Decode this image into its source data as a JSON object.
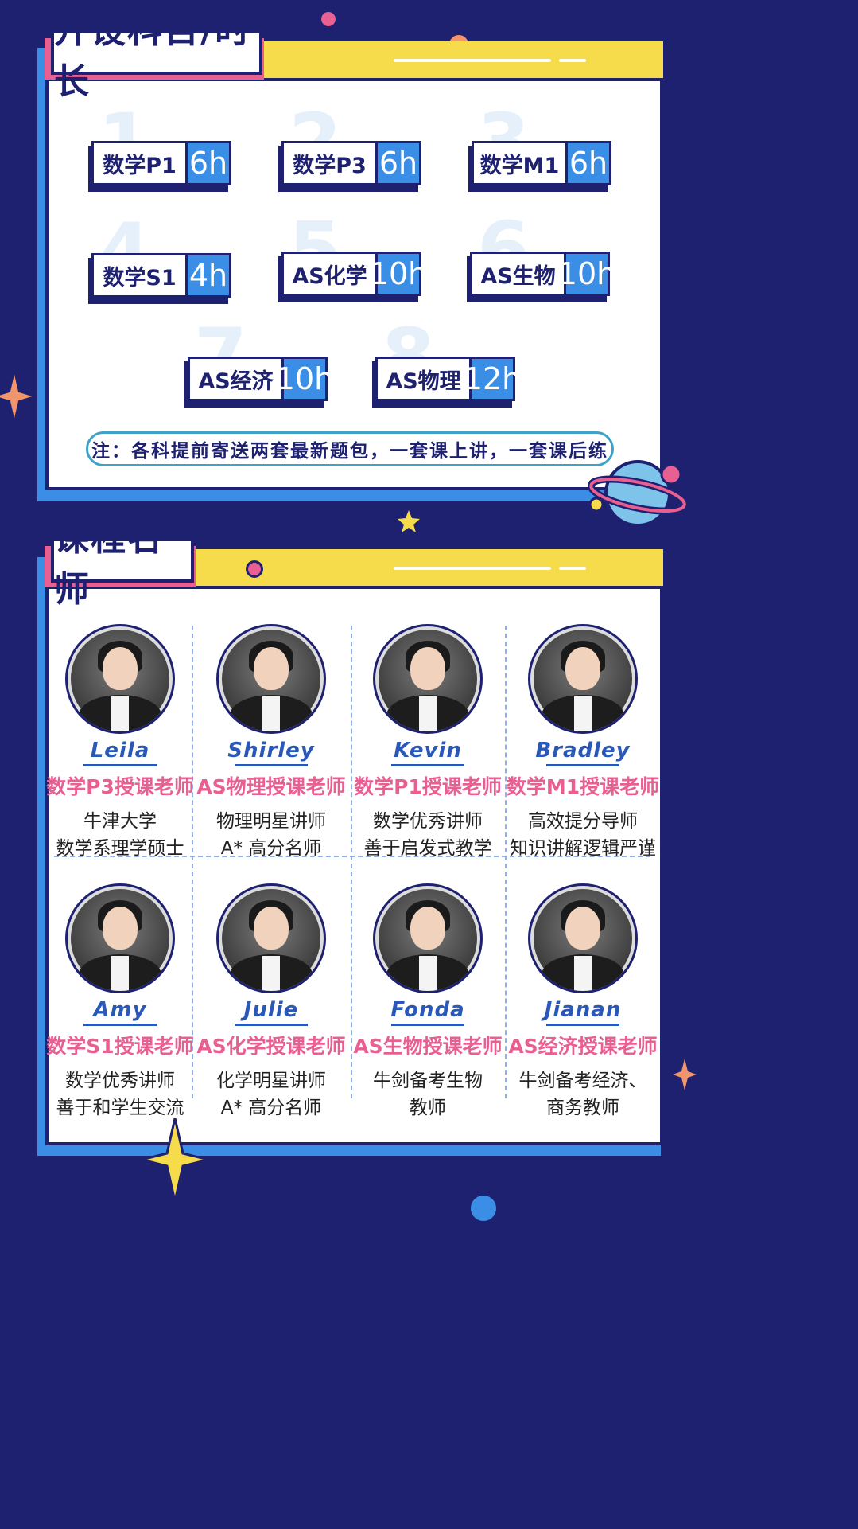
{
  "section1": {
    "title": "开设科目/时长",
    "subjects": [
      {
        "num": "1",
        "name": "数学P1",
        "hours": "6h"
      },
      {
        "num": "2",
        "name": "数学P3",
        "hours": "6h"
      },
      {
        "num": "3",
        "name": "数学M1",
        "hours": "6h"
      },
      {
        "num": "4",
        "name": "数学S1",
        "hours": "4h"
      },
      {
        "num": "5",
        "name": "AS化学",
        "hours": "10h"
      },
      {
        "num": "6",
        "name": "AS生物",
        "hours": "10h"
      },
      {
        "num": "7",
        "name": "AS经济",
        "hours": "10h"
      },
      {
        "num": "8",
        "name": "AS物理",
        "hours": "12h"
      }
    ],
    "note": "注：各科提前寄送两套最新题包，一套课上讲，一套课后练"
  },
  "section2": {
    "title": "课程名师",
    "teachers": [
      {
        "name": "Leila",
        "role": "数学P3授课老师",
        "desc1": "牛津大学",
        "desc2": "数学系理学硕士"
      },
      {
        "name": "Shirley",
        "role": "AS物理授课老师",
        "desc1": "物理明星讲师",
        "desc2": "A* 高分名师"
      },
      {
        "name": "Kevin",
        "role": "数学P1授课老师",
        "desc1": "数学优秀讲师",
        "desc2": "善于启发式教学"
      },
      {
        "name": "Bradley",
        "role": "数学M1授课老师",
        "desc1": "高效提分导师",
        "desc2": "知识讲解逻辑严谨"
      },
      {
        "name": "Amy",
        "role": "数学S1授课老师",
        "desc1": "数学优秀讲师",
        "desc2": "善于和学生交流"
      },
      {
        "name": "Julie",
        "role": "AS化学授课老师",
        "desc1": "化学明星讲师",
        "desc2": "A* 高分名师"
      },
      {
        "name": "Fonda",
        "role": "AS生物授课老师",
        "desc1": "牛剑备考生物",
        "desc2": "教师"
      },
      {
        "name": "Jianan",
        "role": "AS经济授课老师",
        "desc1": "牛剑备考经济、",
        "desc2": "商务教师"
      }
    ]
  },
  "colors": {
    "background": "#1e2070",
    "accent_blue": "#3a8ee6",
    "accent_yellow": "#f6dc4b",
    "accent_pink": "#e85f91",
    "name_blue": "#2a58b8"
  },
  "icons": [
    "star-icon",
    "planet-icon",
    "dot-icon"
  ]
}
